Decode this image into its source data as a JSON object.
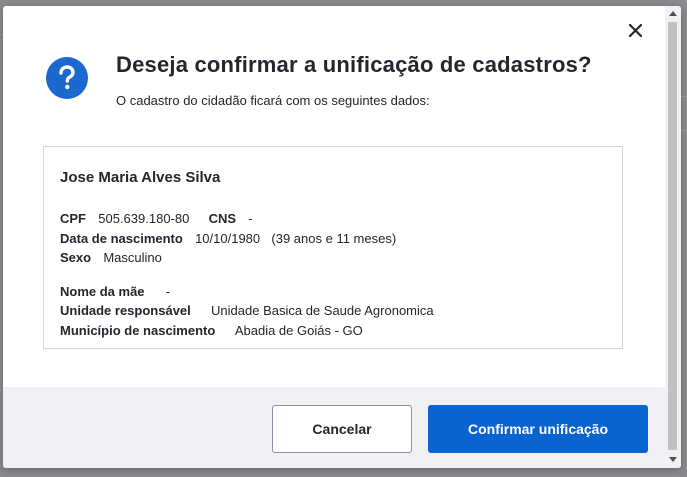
{
  "dialog": {
    "title": "Deseja confirmar a unificação de cadastros?",
    "subtitle": "O cadastro do cidadão ficará com os seguintes dados:",
    "icon": "question-circle-icon",
    "close_icon": "close-icon",
    "accent_color": "#1a68d0"
  },
  "citizen": {
    "name": "Jose Maria Alves Silva",
    "cpf_label": "CPF",
    "cpf": "505.639.180-80",
    "cns_label": "CNS",
    "cns": "-",
    "birth_label": "Data de nascimento",
    "birth": "10/10/1980",
    "age": "(39 anos e 11 meses)",
    "sex_label": "Sexo",
    "sex": "Masculino",
    "mother_label": "Nome da mãe",
    "mother": "-",
    "unit_label": "Unidade responsável",
    "unit": "Unidade Basica de Saude Agronomica",
    "birthplace_label": "Município de nascimento",
    "birthplace": "Abadia de Goiás - GO"
  },
  "actions": {
    "cancel_label": "Cancelar",
    "confirm_label": "Confirmar unificação",
    "confirm_color": "#0a64d0"
  }
}
